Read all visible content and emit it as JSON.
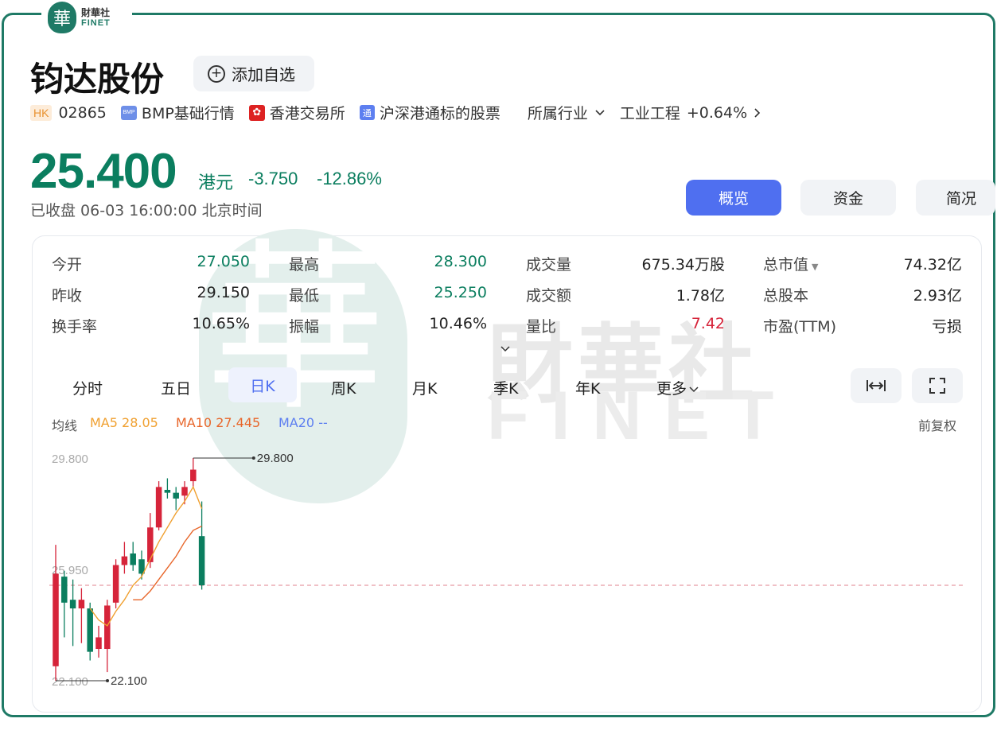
{
  "brand": {
    "seal_char": "華",
    "name_cn": "財華社",
    "name_en": "FINET"
  },
  "header": {
    "title": "钧达股份",
    "watch_button": "添加自选"
  },
  "tags": {
    "market": "HK",
    "code": "02865",
    "bmp_icon": "BMP",
    "bmp": "BMP基础行情",
    "exchange": "香港交易所",
    "connect_icon": "通",
    "connect": "沪深港通标的股票",
    "industry_menu": "所属行业",
    "industry": "工业工程",
    "industry_change": "+0.64%"
  },
  "quote": {
    "price": "25.400",
    "currency": "港元",
    "change": "-3.750",
    "change_pct": "-12.86%",
    "status": "已收盘 06-03 16:00:00 北京时间"
  },
  "tabs": [
    "概览",
    "资金",
    "简况"
  ],
  "stats": {
    "open_label": "今开",
    "open": "27.050",
    "high_label": "最高",
    "high": "28.300",
    "volume_label": "成交量",
    "volume": "675.34万股",
    "mcap_label": "总市值",
    "mcap": "74.32亿",
    "prev_label": "昨收",
    "prev": "29.150",
    "low_label": "最低",
    "low": "25.250",
    "amount_label": "成交额",
    "amount": "1.78亿",
    "shares_label": "总股本",
    "shares": "2.93亿",
    "turnover_label": "换手率",
    "turnover": "10.65%",
    "amplitude_label": "振幅",
    "amplitude": "10.46%",
    "vol_ratio_label": "量比",
    "vol_ratio": "7.42",
    "pe_label": "市盈(TTM)",
    "pe": "亏损"
  },
  "periods": [
    "分时",
    "五日",
    "日K",
    "周K",
    "月K",
    "季K",
    "年K",
    "更多"
  ],
  "ma": {
    "label": "均线",
    "ma5": "MA5 28.05",
    "ma10": "MA10 27.445",
    "ma20": "MA20 --",
    "adjust": "前复权"
  },
  "colors": {
    "up": "#d6243a",
    "down": "#0b7e5f",
    "accent": "#4f6ff0",
    "ma5": "#f0a030",
    "ma10": "#e8662a",
    "ma20": "#5d7ff0"
  },
  "chart_data": {
    "type": "candlestick",
    "axis_labels": [
      "29.800",
      "25.950",
      "22.100"
    ],
    "max_marker": "29.800",
    "min_marker": "22.100",
    "last_close": 25.4,
    "ylim": [
      22.1,
      29.8
    ],
    "candles": [
      {
        "o": 22.6,
        "c": 25.8,
        "h": 26.8,
        "l": 22.1
      },
      {
        "o": 25.7,
        "c": 24.8,
        "h": 25.9,
        "l": 23.6
      },
      {
        "o": 24.9,
        "c": 24.6,
        "h": 25.6,
        "l": 23.3
      },
      {
        "o": 24.6,
        "c": 24.9,
        "h": 25.3,
        "l": 23.4
      },
      {
        "o": 24.6,
        "c": 23.1,
        "h": 24.8,
        "l": 22.8
      },
      {
        "o": 23.2,
        "c": 23.6,
        "h": 24.0,
        "l": 22.9
      },
      {
        "o": 23.2,
        "c": 24.7,
        "h": 24.9,
        "l": 22.4
      },
      {
        "o": 24.8,
        "c": 26.1,
        "h": 26.3,
        "l": 24.6
      },
      {
        "o": 26.1,
        "c": 26.4,
        "h": 26.9,
        "l": 25.8
      },
      {
        "o": 26.5,
        "c": 26.1,
        "h": 26.9,
        "l": 25.9
      },
      {
        "o": 26.3,
        "c": 25.8,
        "h": 26.6,
        "l": 25.6
      },
      {
        "o": 26.2,
        "c": 27.4,
        "h": 27.9,
        "l": 26.0
      },
      {
        "o": 27.4,
        "c": 28.8,
        "h": 29.0,
        "l": 27.3
      },
      {
        "o": 28.7,
        "c": 28.6,
        "h": 29.1,
        "l": 28.4
      },
      {
        "o": 28.6,
        "c": 28.4,
        "h": 28.8,
        "l": 28.0
      },
      {
        "o": 28.5,
        "c": 28.8,
        "h": 29.0,
        "l": 28.2
      },
      {
        "o": 29.0,
        "c": 29.4,
        "h": 29.8,
        "l": 28.8
      },
      {
        "o": 27.1,
        "c": 25.4,
        "h": 28.3,
        "l": 25.25
      }
    ],
    "ma5": [
      null,
      null,
      null,
      null,
      24.6,
      24.2,
      24.0,
      24.5,
      24.9,
      25.4,
      25.7,
      26.3,
      26.9,
      27.4,
      27.9,
      28.3,
      28.8,
      28.05
    ],
    "ma10": [
      null,
      null,
      null,
      null,
      null,
      null,
      null,
      null,
      null,
      24.9,
      24.9,
      25.2,
      25.6,
      26.0,
      26.4,
      26.9,
      27.3,
      27.445
    ]
  }
}
